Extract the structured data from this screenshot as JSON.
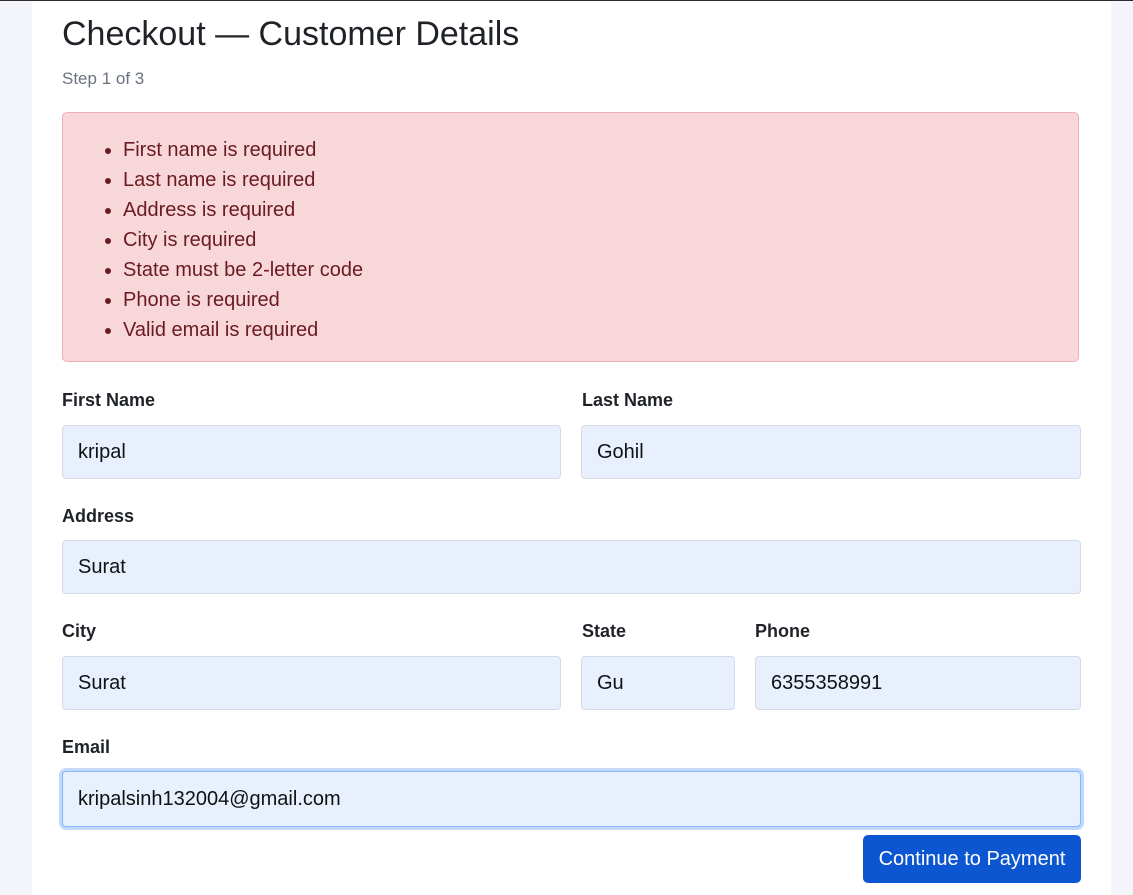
{
  "page": {
    "title": "Checkout — Customer Details",
    "step": "Step 1 of 3"
  },
  "errors": [
    "First name is required",
    "Last name is required",
    "Address is required",
    "City is required",
    "State must be 2-letter code",
    "Phone is required",
    "Valid email is required"
  ],
  "form": {
    "first_name": {
      "label": "First Name",
      "value": "kripal"
    },
    "last_name": {
      "label": "Last Name",
      "value": "Gohil"
    },
    "address": {
      "label": "Address",
      "value": "Surat"
    },
    "city": {
      "label": "City",
      "value": "Surat"
    },
    "state": {
      "label": "State",
      "value": "Gu"
    },
    "phone": {
      "label": "Phone",
      "value": "6355358991"
    },
    "email": {
      "label": "Email",
      "value": "kripalsinh132004@gmail.com"
    }
  },
  "actions": {
    "continue_label": "Continue to Payment"
  },
  "colors": {
    "primary": "#0d56d2",
    "error_bg": "#f8d7da",
    "error_text": "#6a1a21",
    "input_bg": "#e8f0fe"
  }
}
